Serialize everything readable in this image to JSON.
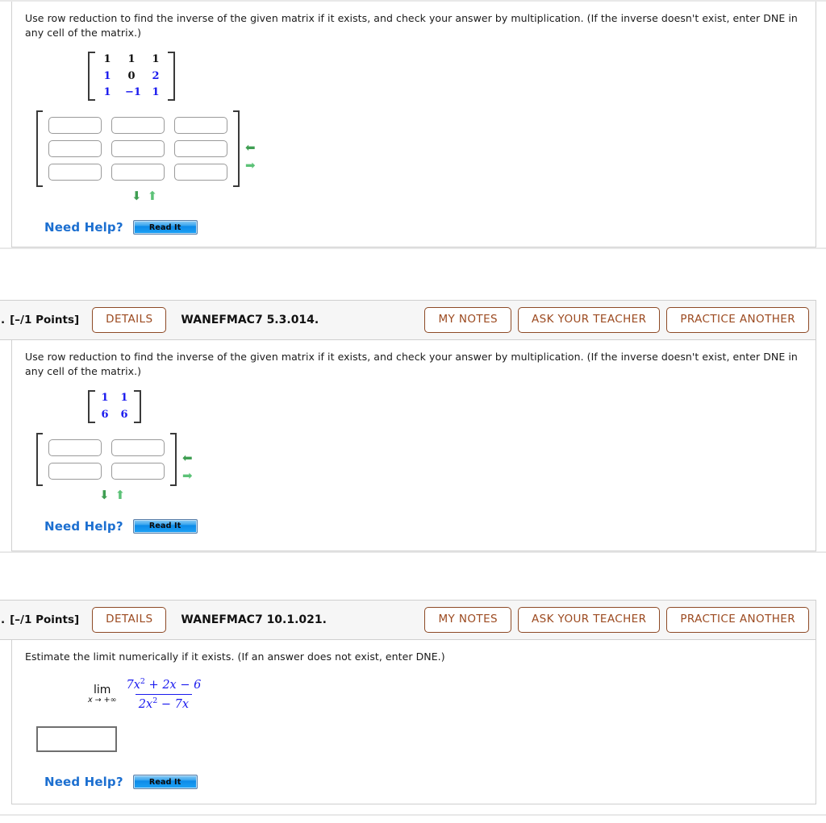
{
  "colors": {
    "accent_brown": "#9c4a20",
    "matrix_blue": "#1a1aee",
    "link_blue": "#1c6fd0",
    "arrow_green": "#3f9e52",
    "panel_border": "#cfcfcf",
    "header_bg": "#f6f6f6"
  },
  "questions": [
    {
      "id": "q-top",
      "prompt": "Use row reduction to find the inverse of the given matrix if it exists, and check your answer by multiplication. (If the inverse doesn't exist, enter DNE in any cell of the matrix.)",
      "given_matrix": {
        "rows": 3,
        "cols": 3,
        "cells": [
          [
            {
              "v": "1",
              "color": "black"
            },
            {
              "v": "1",
              "color": "black"
            },
            {
              "v": "1",
              "color": "black"
            }
          ],
          [
            {
              "v": "1",
              "color": "blue"
            },
            {
              "v": "0",
              "color": "black"
            },
            {
              "v": "2",
              "color": "blue"
            }
          ],
          [
            {
              "v": "1",
              "color": "blue"
            },
            {
              "v": "−1",
              "color": "blue"
            },
            {
              "v": "1",
              "color": "blue"
            }
          ]
        ]
      },
      "answer_matrix": {
        "rows": 3,
        "cols": 3,
        "values": [
          "",
          "",
          "",
          "",
          "",
          "",
          "",
          "",
          ""
        ],
        "placeholder": ""
      },
      "controls": {
        "remove_col_icon": "arrow-left-icon",
        "add_col_icon": "arrow-right-icon",
        "remove_row_icon": "arrow-down-icon",
        "add_row_icon": "arrow-up-icon"
      },
      "need_help": {
        "label": "Need Help?",
        "button": "Read It"
      }
    },
    {
      "id": "q-middle",
      "header": {
        "number": ".",
        "points": "[–/1 Points]",
        "details_label": "DETAILS",
        "code": "WANEFMAC7 5.3.014.",
        "my_notes_label": "MY NOTES",
        "ask_teacher_label": "ASK YOUR TEACHER",
        "practice_another_label": "PRACTICE ANOTHER"
      },
      "prompt": "Use row reduction to find the inverse of the given matrix if it exists, and check your answer by multiplication. (If the inverse doesn't exist, enter DNE in any cell of the matrix.)",
      "given_matrix": {
        "rows": 2,
        "cols": 2,
        "cells": [
          [
            {
              "v": "1",
              "color": "blue"
            },
            {
              "v": "1",
              "color": "blue"
            }
          ],
          [
            {
              "v": "6",
              "color": "blue"
            },
            {
              "v": "6",
              "color": "blue"
            }
          ]
        ]
      },
      "answer_matrix": {
        "rows": 2,
        "cols": 2,
        "values": [
          "",
          "",
          "",
          ""
        ],
        "placeholder": ""
      },
      "controls": {
        "remove_col_icon": "arrow-left-icon",
        "add_col_icon": "arrow-right-icon",
        "remove_row_icon": "arrow-down-icon",
        "add_row_icon": "arrow-up-icon"
      },
      "need_help": {
        "label": "Need Help?",
        "button": "Read It"
      }
    },
    {
      "id": "q-bottom",
      "header": {
        "number": ".",
        "points": "[–/1 Points]",
        "details_label": "DETAILS",
        "code": "WANEFMAC7 10.1.021.",
        "my_notes_label": "MY NOTES",
        "ask_teacher_label": "ASK YOUR TEACHER",
        "practice_another_label": "PRACTICE ANOTHER"
      },
      "prompt": "Estimate the limit numerically if it exists. (If an answer does not exist, enter DNE.)",
      "limit": {
        "operator": "lim",
        "subscript": "x → +∞",
        "numerator": "7x² + 2x − 6",
        "denominator": "2x² − 7x",
        "num_parts": {
          "a": "7x",
          "a_exp": "2",
          "b": " + 2x − 6"
        },
        "den_parts": {
          "a": "2x",
          "a_exp": "2",
          "b": " − 7x"
        }
      },
      "answer_field": {
        "value": "",
        "placeholder": ""
      },
      "need_help": {
        "label": "Need Help?",
        "button": "Read It"
      }
    }
  ]
}
